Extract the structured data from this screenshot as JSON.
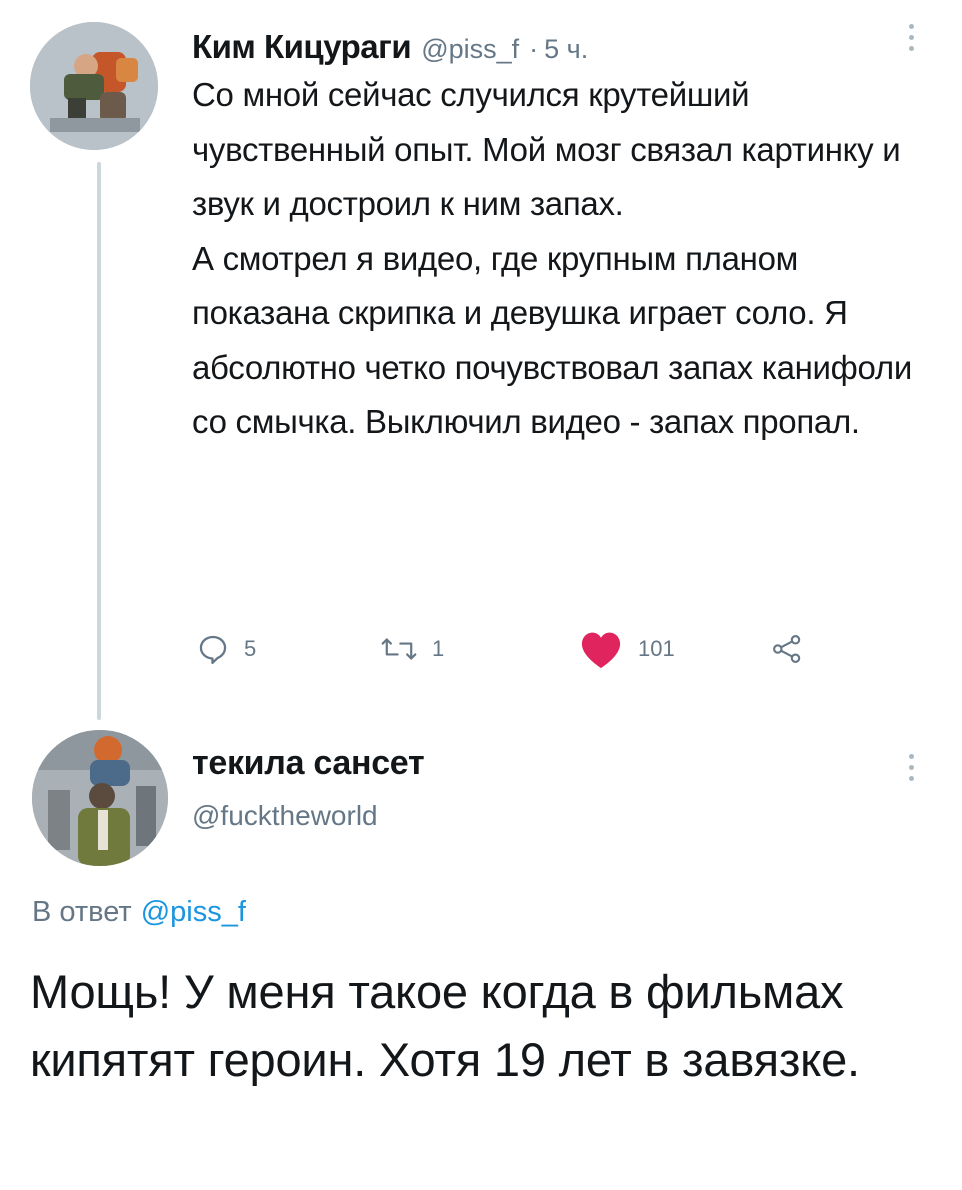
{
  "tweet": {
    "author_name": "Ким Кицураги",
    "handle": "@piss_f",
    "separator": "·",
    "time": "5 ч.",
    "paragraphs": [
      "Со мной сейчас случился крутейший чувственный опыт. Мой мозг связал картинку и звук и достроил к ним запах.",
      "А смотрел я видео, где крупным планом показана скрипка и девушка играет соло. Я абсолютно четко почувствовал запах канифоли со смычка. Выключил видео - запах пропал."
    ],
    "actions": {
      "reply_count": "5",
      "retweet_count": "1",
      "like_count": "101",
      "icons": [
        "reply-icon",
        "retweet-icon",
        "like-icon",
        "share-icon"
      ]
    }
  },
  "reply": {
    "author_name": "текила сансет",
    "handle": "@fucktheworld",
    "reply_label": "В ответ",
    "reply_mention": "@piss_f",
    "text": "Мощь! У меня такое когда в фильмах кипятят героин. Хотя 19 лет в завязке."
  },
  "colors": {
    "like": "#e0245e",
    "secondary_text": "#657786",
    "link": "#1b95e0",
    "thread_line": "#ccd6dd"
  }
}
